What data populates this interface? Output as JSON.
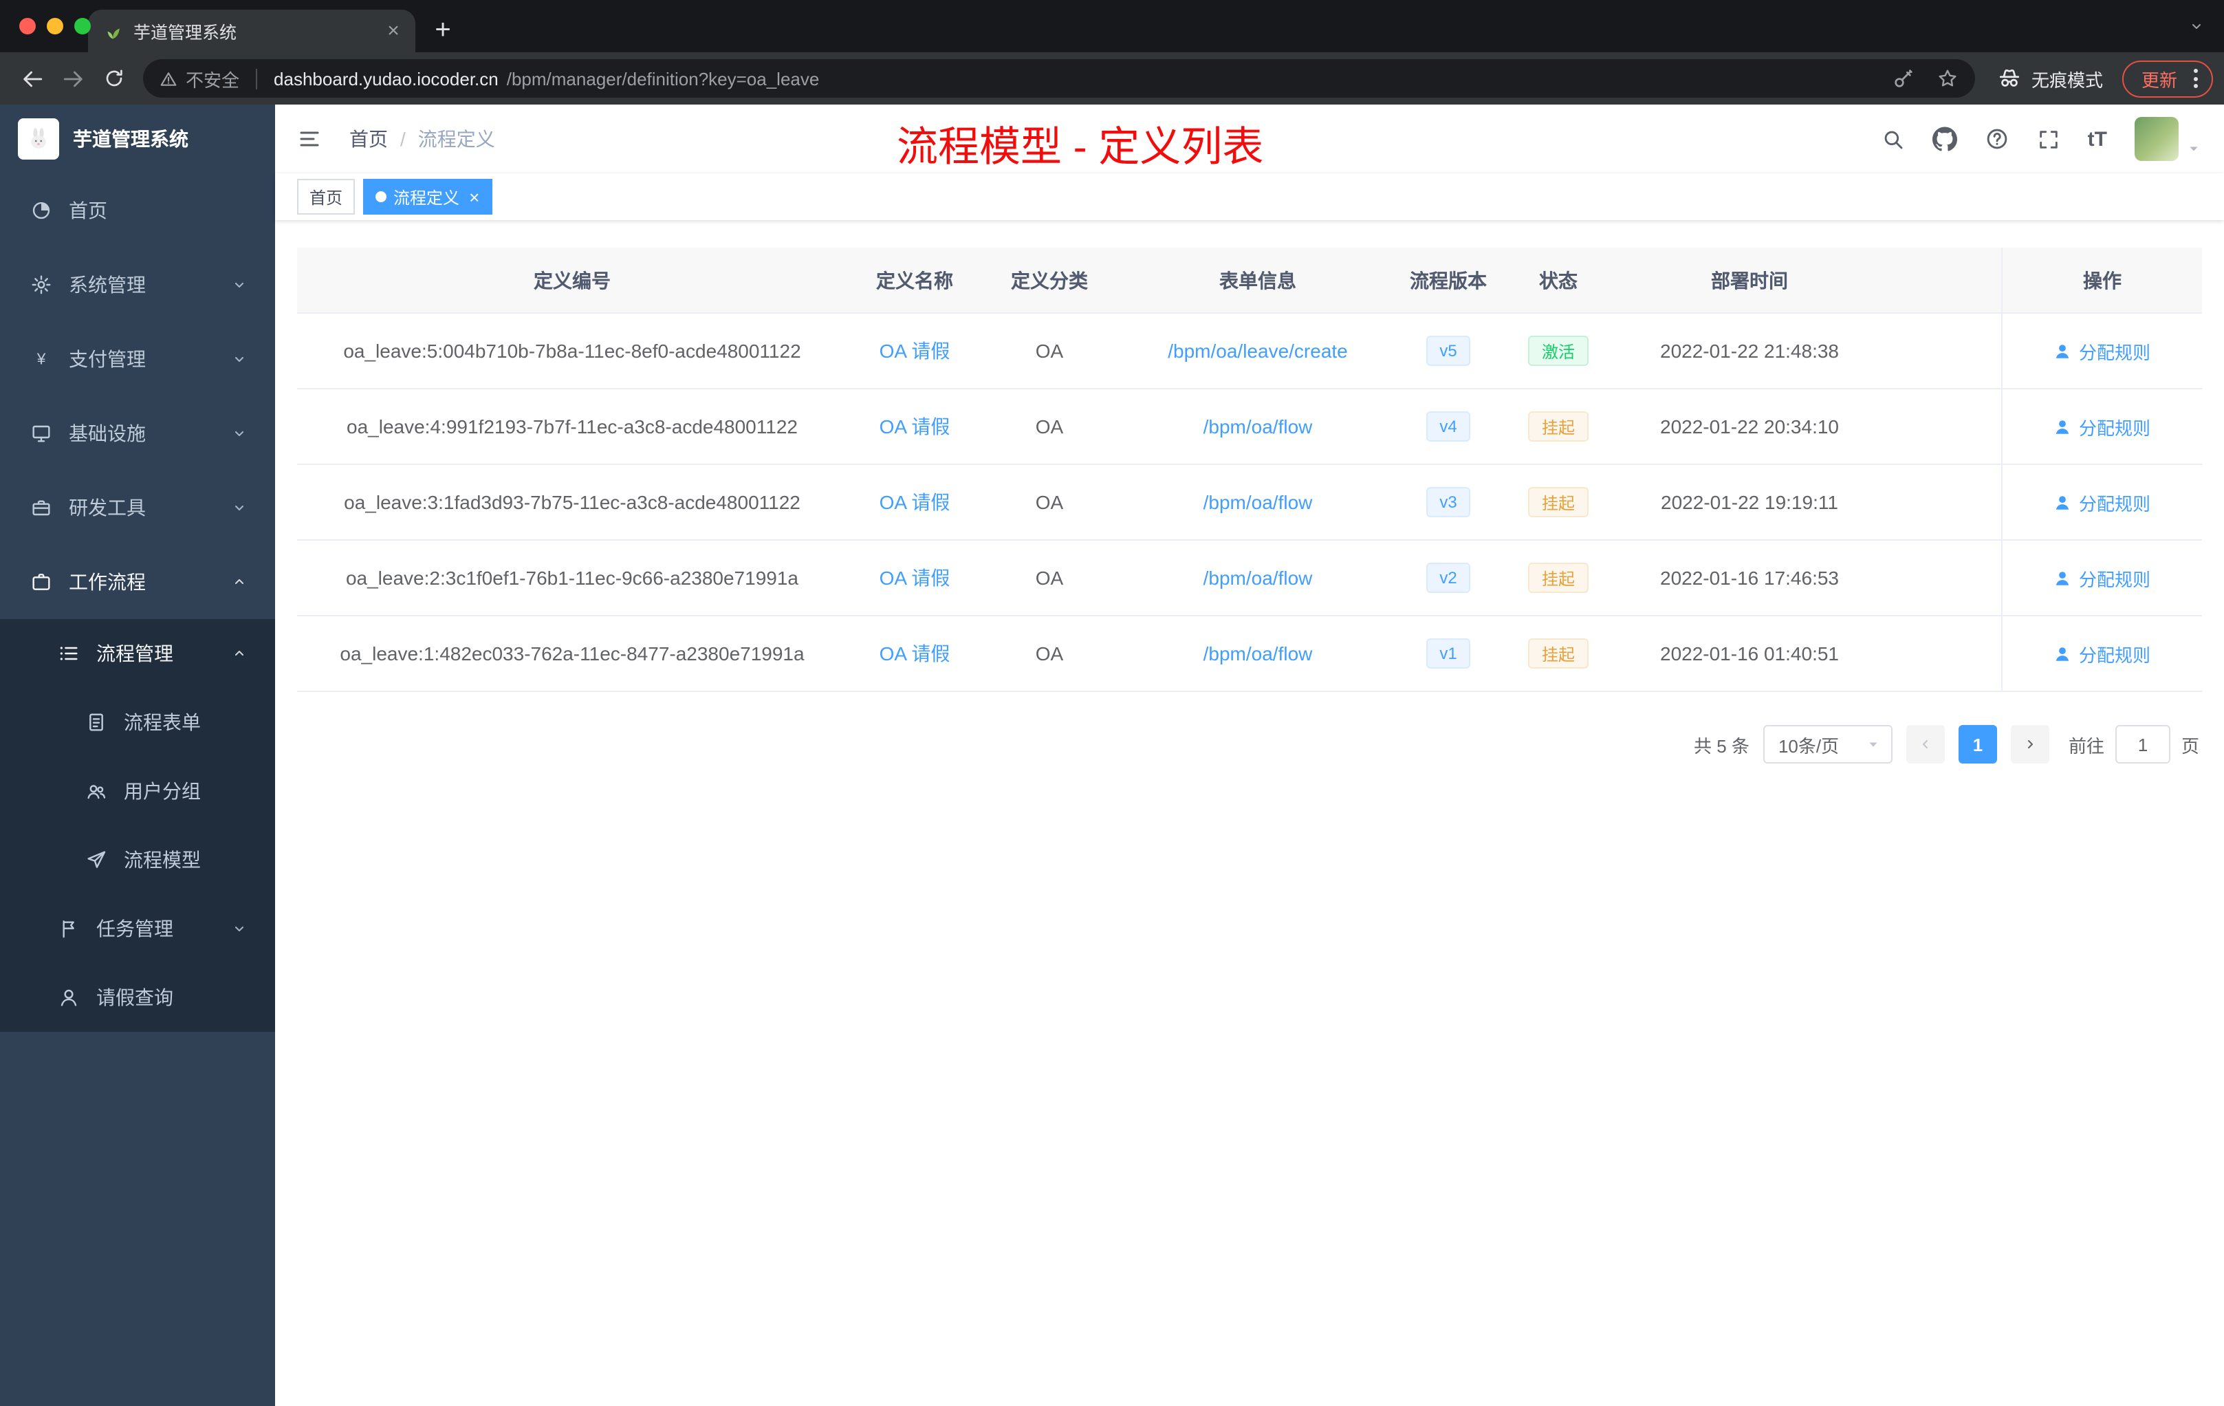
{
  "browser": {
    "tab": {
      "title": "芋道管理系统"
    },
    "security_label": "不安全",
    "url_host": "dashboard.yudao.iocoder.cn",
    "url_path": "/bpm/manager/definition?key=oa_leave",
    "incognito_label": "无痕模式",
    "update_label": "更新"
  },
  "sidebar": {
    "logo_title": "芋道管理系统",
    "menu": [
      {
        "key": "home",
        "label": "首页",
        "icon": "dashboard-icon",
        "level": 1,
        "dark": false,
        "active": false,
        "chevron": null
      },
      {
        "key": "system-management",
        "label": "系统管理",
        "icon": "gear-icon",
        "level": 1,
        "dark": false,
        "active": false,
        "chevron": "down"
      },
      {
        "key": "payment-management",
        "label": "支付管理",
        "icon": "yen-icon",
        "level": 1,
        "dark": false,
        "active": false,
        "chevron": "down"
      },
      {
        "key": "infrastructure",
        "label": "基础设施",
        "icon": "monitor-icon",
        "level": 1,
        "dark": false,
        "active": false,
        "chevron": "down"
      },
      {
        "key": "dev-tools",
        "label": "研发工具",
        "icon": "toolbox-icon",
        "level": 1,
        "dark": false,
        "active": false,
        "chevron": "down"
      },
      {
        "key": "workflow",
        "label": "工作流程",
        "icon": "briefcase-icon",
        "level": 1,
        "dark": false,
        "active": true,
        "chevron": "up"
      },
      {
        "key": "process-management",
        "label": "流程管理",
        "icon": "list-icon",
        "level": 2,
        "dark": true,
        "active": true,
        "chevron": "up"
      },
      {
        "key": "process-form",
        "label": "流程表单",
        "icon": "form-icon",
        "level": 3,
        "dark": true,
        "active": false,
        "chevron": null
      },
      {
        "key": "user-group",
        "label": "用户分组",
        "icon": "users-icon",
        "level": 3,
        "dark": true,
        "active": false,
        "chevron": null
      },
      {
        "key": "process-model",
        "label": "流程模型",
        "icon": "send-icon",
        "level": 3,
        "dark": true,
        "active": false,
        "chevron": null
      },
      {
        "key": "task-management",
        "label": "任务管理",
        "icon": "flag-icon",
        "level": 2,
        "dark": true,
        "active": false,
        "chevron": "down"
      },
      {
        "key": "leave-query",
        "label": "请假查询",
        "icon": "user-icon",
        "level": 2,
        "dark": true,
        "active": false,
        "chevron": null
      }
    ]
  },
  "header": {
    "breadcrumb": [
      "首页",
      "流程定义"
    ],
    "breadcrumb_separator": "/",
    "annotation": "流程模型 - 定义列表",
    "font_size_icon": "tT"
  },
  "tags": [
    {
      "key": "home",
      "label": "首页",
      "active": false
    },
    {
      "key": "process-definition",
      "label": "流程定义",
      "active": true
    }
  ],
  "table": {
    "columns": [
      "定义编号",
      "定义名称",
      "定义分类",
      "表单信息",
      "流程版本",
      "状态",
      "部署时间",
      "操作"
    ],
    "rows": [
      {
        "id": "oa_leave:5:004b710b-7b8a-11ec-8ef0-acde48001122",
        "name": "OA 请假",
        "category": "OA",
        "form": "/bpm/oa/leave/create",
        "version": "v5",
        "status": "激活",
        "status_type": "success",
        "time": "2022-01-22 21:48:38",
        "action": "分配规则"
      },
      {
        "id": "oa_leave:4:991f2193-7b7f-11ec-a3c8-acde48001122",
        "name": "OA 请假",
        "category": "OA",
        "form": "/bpm/oa/flow",
        "version": "v4",
        "status": "挂起",
        "status_type": "warning",
        "time": "2022-01-22 20:34:10",
        "action": "分配规则"
      },
      {
        "id": "oa_leave:3:1fad3d93-7b75-11ec-a3c8-acde48001122",
        "name": "OA 请假",
        "category": "OA",
        "form": "/bpm/oa/flow",
        "version": "v3",
        "status": "挂起",
        "status_type": "warning",
        "time": "2022-01-22 19:19:11",
        "action": "分配规则"
      },
      {
        "id": "oa_leave:2:3c1f0ef1-76b1-11ec-9c66-a2380e71991a",
        "name": "OA 请假",
        "category": "OA",
        "form": "/bpm/oa/flow",
        "version": "v2",
        "status": "挂起",
        "status_type": "warning",
        "time": "2022-01-16 17:46:53",
        "action": "分配规则"
      },
      {
        "id": "oa_leave:1:482ec033-762a-11ec-8477-a2380e71991a",
        "name": "OA 请假",
        "category": "OA",
        "form": "/bpm/oa/flow",
        "version": "v1",
        "status": "挂起",
        "status_type": "warning",
        "time": "2022-01-16 01:40:51",
        "action": "分配规则"
      }
    ]
  },
  "pagination": {
    "total": "共 5 条",
    "page_size": "10条/页",
    "page": "1",
    "goto_label": "前往",
    "goto_value": "1",
    "unit_label": "页"
  },
  "colors": {
    "accent": "#409eff",
    "success": "#13ce66",
    "warning": "#e6a23c",
    "sidebar_bg": "#304156",
    "sidebar_submenu_bg": "#1f2d3d",
    "annotation_red": "#f20d0d",
    "traffic_lights": [
      "#ff5f57",
      "#febc2e",
      "#28c840"
    ]
  }
}
